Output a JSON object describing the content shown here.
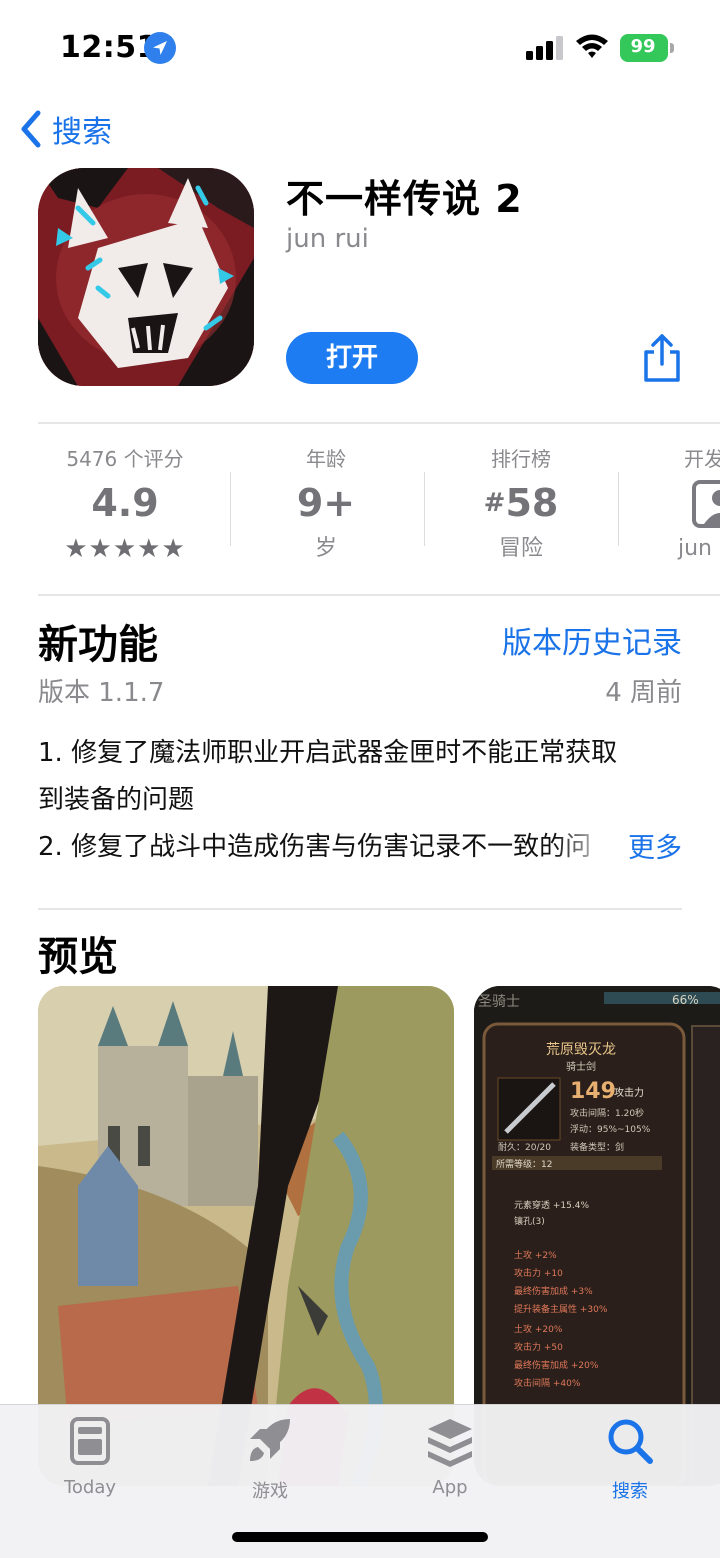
{
  "status_bar": {
    "time": "12:51",
    "battery": "99",
    "icons": [
      "location-arrow-icon",
      "cellular-signal-icon",
      "wifi-icon",
      "battery-charging-icon"
    ],
    "battery_color": "#34c759"
  },
  "nav": {
    "back_label": "搜索",
    "back_icon": "chevron-left-icon"
  },
  "app": {
    "title": "不一样传说 2",
    "developer": "jun rui",
    "open_label": "打开",
    "share_icon": "share-icon",
    "accent": "#1e7cf2"
  },
  "info": {
    "ratings": {
      "label": "5476 个评分",
      "value": "4.9",
      "stars": "★★★★★",
      "star_count": 5
    },
    "age": {
      "label": "年龄",
      "value": "9+",
      "sub": "岁"
    },
    "chart": {
      "label": "排行榜",
      "hash": "#",
      "value": "58",
      "sub": "冒险"
    },
    "developer": {
      "label": "开发",
      "sub": "jun",
      "icon": "person-icon"
    }
  },
  "whats_new": {
    "title": "新功能",
    "history_link": "版本历史记录",
    "version": "版本 1.1.7",
    "date": "4 周前",
    "notes_line1": "1. 修复了魔法师职业开启武器金匣时不能正常获取",
    "notes_line2": "到装备的问题",
    "notes_line3": "2. 修复了战斗中造成伤害与伤害记录不一致的问",
    "more": "更多"
  },
  "preview": {
    "title": "预览",
    "shot2_texts": {
      "top_label": "圣骑士",
      "percent": "66%",
      "item_name": "荒原毁灭龙",
      "item_type": "骑士剑",
      "attack": "149",
      "attack_label": "攻击力",
      "interval": "攻击间隔：1.20秒",
      "float": "浮动：95%~105%",
      "durability": "耐久：20/20",
      "equip_type": "装备类型：剑",
      "req_level": "所需等级：12",
      "attr1": "元素穿透 +15.4%",
      "attr2": "镶孔(3)",
      "attr3": "土攻 +2%",
      "attr4": "攻击力 +10",
      "attr5": "最终伤害加成 +3%",
      "attr6": "提升装备主属性 +30%",
      "attr7": "土攻 +20%",
      "attr8": "攻击力 +50",
      "attr9": "最终伤害加成 +20%",
      "attr10": "攻击间隔 +40%"
    }
  },
  "tab_bar": {
    "tabs": [
      {
        "label": "Today",
        "icon": "today-icon"
      },
      {
        "label": "游戏",
        "icon": "rocket-icon"
      },
      {
        "label": "App",
        "icon": "layers-icon"
      },
      {
        "label": "搜索",
        "icon": "search-icon",
        "active": true
      }
    ],
    "active_color": "#1a73e8"
  }
}
